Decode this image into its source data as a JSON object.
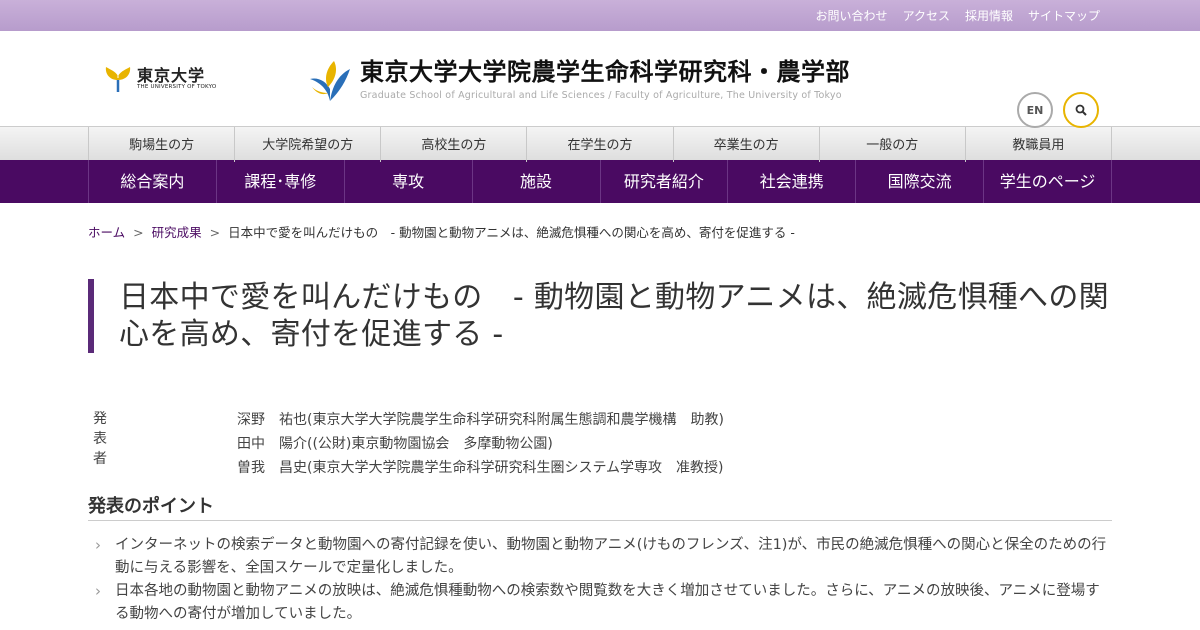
{
  "topbar": {
    "links": [
      "お問い合わせ",
      "アクセス",
      "採用情報",
      "サイトマップ"
    ]
  },
  "header": {
    "ut_logo_text": "東京大学",
    "ut_logo_sub": "THE UNIVERSITY OF TOKYO",
    "title": "東京大学大学院農学生命科学研究科・農学部",
    "subtitle": "Graduate School of Agricultural and Life Sciences / Faculty of Agriculture, The University of Tokyo",
    "lang_button": "EN"
  },
  "nav_audience": [
    "駒場生の方",
    "大学院希望の方",
    "高校生の方",
    "在学生の方",
    "卒業生の方",
    "一般の方",
    "教職員用"
  ],
  "nav_main": [
    "総合案内",
    "課程･専修",
    "専攻",
    "施設",
    "研究者紹介",
    "社会連携",
    "国際交流",
    "学生のページ"
  ],
  "breadcrumb": {
    "home": "ホーム",
    "section": "研究成果",
    "current": "日本中で愛を叫んだけもの　- 動物園と動物アニメは、絶滅危惧種への関心を高め、寄付を促進する -",
    "separator": ">"
  },
  "article": {
    "title": "日本中で愛を叫んだけもの　- 動物園と動物アニメは、絶滅危惧種への関心を高め、寄付を促進する -",
    "presenters_label": "発表者",
    "presenters": [
      "深野　祐也(東京大学大学院農学生命科学研究科附属生態調和農学機構　助教)",
      "田中　陽介((公財)東京動物園協会　多摩動物公園)",
      "曽我　昌史(東京大学大学院農学生命科学研究科生圏システム学専攻　准教授)"
    ],
    "points_heading": "発表のポイント",
    "points": [
      "インターネットの検索データと動物園への寄付記録を使い、動物園と動物アニメ(けものフレンズ、注1)が、市民の絶滅危惧種への関心と保全のための行動に与える影響を、全国スケールで定量化しました。",
      "日本各地の動物園と動物アニメの放映は、絶滅危惧種動物への検索数や閲覧数を大きく増加させていました。さらに、アニメの放映後、アニメに登場する動物への寄付が増加していました。"
    ]
  },
  "colors": {
    "topbar": "#b79ccc",
    "nav_main_bg": "#4a0a62",
    "title_bar": "#5a2a78",
    "search_ring": "#e8b400"
  }
}
